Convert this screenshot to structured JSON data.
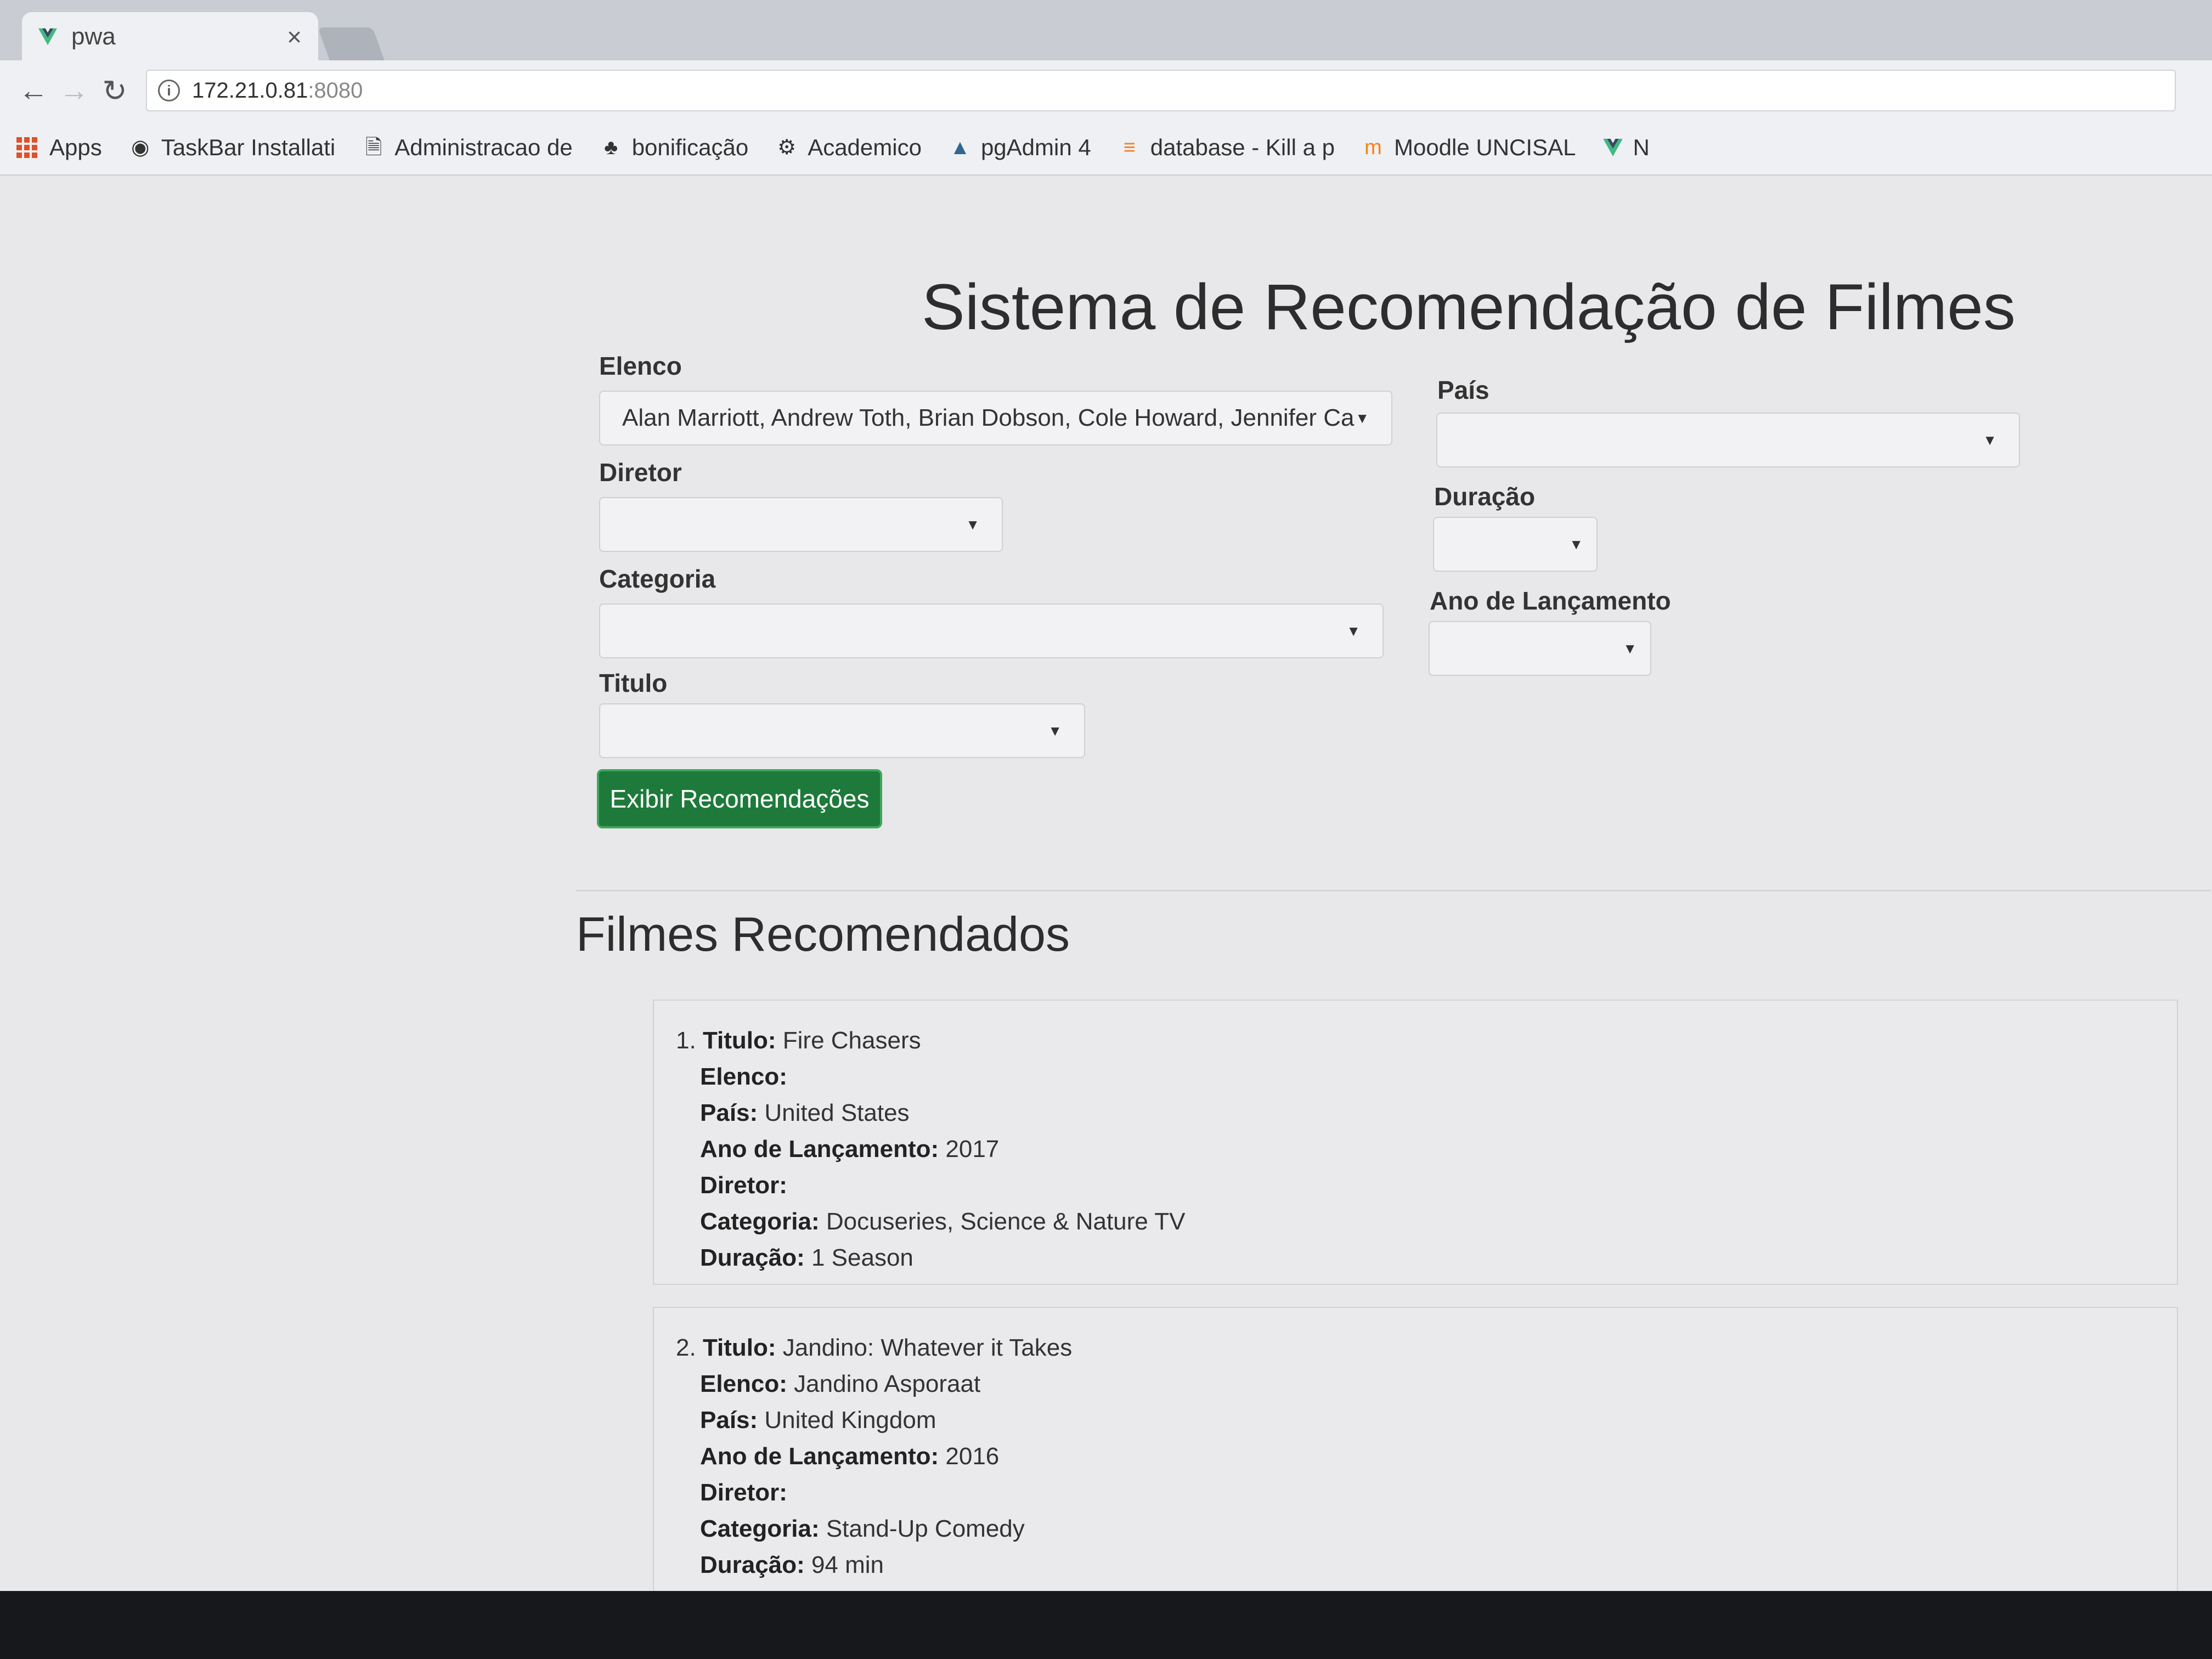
{
  "browser": {
    "tab_title": "pwa",
    "tab_close": "×",
    "url_host": "172.21.0.81",
    "url_port": ":8080",
    "bookmarks": [
      {
        "label": "Apps"
      },
      {
        "label": "TaskBar Installati"
      },
      {
        "label": "Administracao de"
      },
      {
        "label": "bonificação"
      },
      {
        "label": "Academico"
      },
      {
        "label": "pgAdmin 4"
      },
      {
        "label": "database - Kill a p"
      },
      {
        "label": "Moodle UNCISAL"
      },
      {
        "label": "N"
      }
    ]
  },
  "page": {
    "title": "Sistema de Recomendação de Filmes",
    "filters": {
      "elenco": {
        "label": "Elenco",
        "value": "Alan Marriott, Andrew Toth, Brian Dobson, Cole Howard, Jennifer Cameron"
      },
      "diretor": {
        "label": "Diretor",
        "value": ""
      },
      "categoria": {
        "label": "Categoria",
        "value": ""
      },
      "titulo": {
        "label": "Titulo",
        "value": ""
      },
      "pais": {
        "label": "País",
        "value": ""
      },
      "duracao": {
        "label": "Duração",
        "value": ""
      },
      "ano": {
        "label": "Ano de Lançamento",
        "value": ""
      }
    },
    "submit_label": "Exibir Recomendações",
    "results_title": "Filmes Recomendados",
    "field_labels": {
      "titulo": "Titulo:",
      "elenco": "Elenco:",
      "pais": "País:",
      "ano": "Ano de Lançamento:",
      "diretor": "Diretor:",
      "categoria": "Categoria:",
      "duracao": "Duração:"
    },
    "results": [
      {
        "number": "1.",
        "titulo": "Fire Chasers",
        "elenco": "",
        "pais": "United States",
        "ano": "2017",
        "diretor": "",
        "categoria": "Docuseries, Science & Nature TV",
        "duracao": "1 Season"
      },
      {
        "number": "2.",
        "titulo": "Jandino: Whatever it Takes",
        "elenco": "Jandino Asporaat",
        "pais": "United Kingdom",
        "ano": "2016",
        "diretor": "",
        "categoria": "Stand-Up Comedy",
        "duracao": "94 min"
      }
    ]
  },
  "colors": {
    "button": "#1d7a3a",
    "vue_green": "#42b883"
  }
}
